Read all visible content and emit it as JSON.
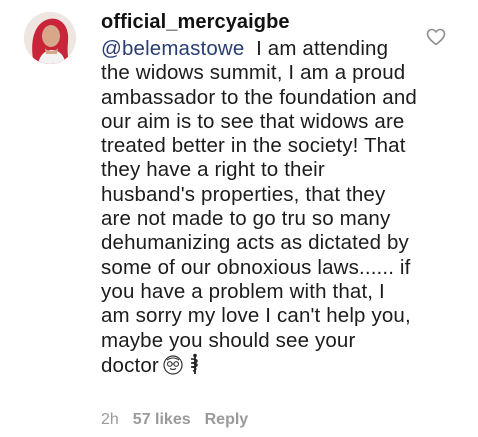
{
  "comment": {
    "username": "official_mercyaigbe",
    "mention": "@belemastowe",
    "text": "I am attending the widows summit, I am a proud ambassador to the foundation and our aim is to see that widows are treated better in the society! That they have a right to their husband's properties, that they are not made to go tru so many dehumanizing acts as dictated by some of our obnoxious laws...... if you have a problem with that, I am sorry my love I can't help you, maybe you should see your doctor",
    "emojis": [
      "nerd-face-emoji",
      "medical-symbol-emoji"
    ]
  },
  "meta": {
    "time": "2h",
    "likes": "57 likes",
    "reply": "Reply"
  },
  "colors": {
    "mention": "#2a3d73",
    "meta": "#9a9a9a",
    "text": "#1c1c1c"
  }
}
